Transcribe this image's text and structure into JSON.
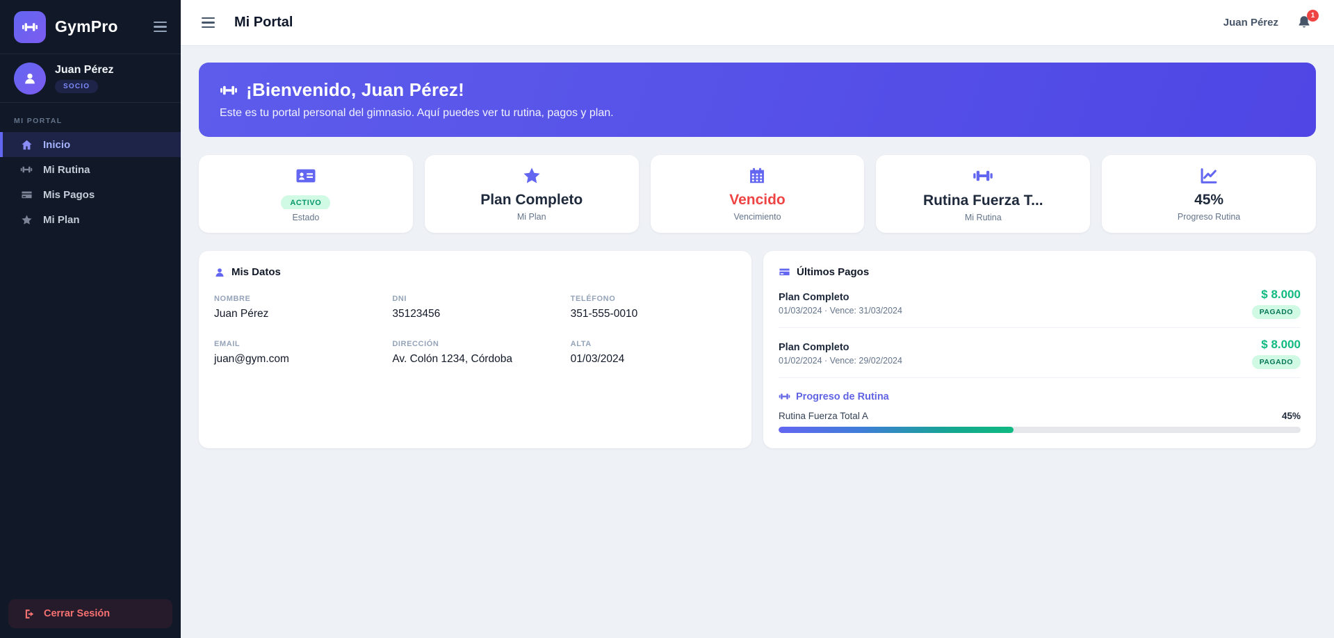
{
  "app": {
    "name": "GymPro"
  },
  "sidebar": {
    "user": {
      "name": "Juan Pérez",
      "role_badge": "SOCIO"
    },
    "section_label": "MI PORTAL",
    "items": [
      {
        "label": "Inicio",
        "icon": "home-icon",
        "active": true
      },
      {
        "label": "Mi Rutina",
        "icon": "dumbbell-icon",
        "active": false
      },
      {
        "label": "Mis Pagos",
        "icon": "credit-card-icon",
        "active": false
      },
      {
        "label": "Mi Plan",
        "icon": "star-icon",
        "active": false
      }
    ],
    "logout_label": "Cerrar Sesión"
  },
  "topbar": {
    "title": "Mi Portal",
    "user_name": "Juan Pérez",
    "notification_count": "1"
  },
  "banner": {
    "title": "¡Bienvenido, Juan Pérez!",
    "subtitle": "Este es tu portal personal del gimnasio. Aquí puedes ver tu rutina, pagos y plan."
  },
  "stats": [
    {
      "icon": "id-card-icon",
      "value": "ACTIVO",
      "label": "Estado"
    },
    {
      "icon": "star-icon",
      "value": "Plan Completo",
      "label": "Mi Plan"
    },
    {
      "icon": "calendar-icon",
      "value": "Vencido",
      "label": "Vencimiento",
      "color": "#ef4444"
    },
    {
      "icon": "dumbbell-icon",
      "value": "Rutina Fuerza T...",
      "label": "Mi Rutina"
    },
    {
      "icon": "chart-line-icon",
      "value": "45%",
      "label": "Progreso Rutina"
    }
  ],
  "mis_datos": {
    "title": "Mis Datos",
    "fields": [
      {
        "label": "NOMBRE",
        "value": "Juan Pérez"
      },
      {
        "label": "DNI",
        "value": "35123456"
      },
      {
        "label": "TELÉFONO",
        "value": "351-555-0010"
      },
      {
        "label": "EMAIL",
        "value": "juan@gym.com"
      },
      {
        "label": "DIRECCIÓN",
        "value": "Av. Colón 1234, Córdoba"
      },
      {
        "label": "ALTA",
        "value": "01/03/2024"
      }
    ]
  },
  "pagos": {
    "title": "Últimos Pagos",
    "items": [
      {
        "plan": "Plan Completo",
        "dates": "01/03/2024 · Vence: 31/03/2024",
        "amount": "$ 8.000",
        "status": "PAGADO"
      },
      {
        "plan": "Plan Completo",
        "dates": "01/02/2024 · Vence: 29/02/2024",
        "amount": "$ 8.000",
        "status": "PAGADO"
      }
    ],
    "progress": {
      "title": "Progreso de Rutina",
      "routine": "Rutina Fuerza Total A",
      "percent": "45%",
      "percent_value": 45
    }
  },
  "colors": {
    "accent": "#6366f1",
    "banner_gradient_start": "#5d5ceb",
    "banner_gradient_end": "#4f46e5",
    "danger": "#ef4444",
    "success": "#10b981",
    "sidebar_bg": "#111827"
  }
}
